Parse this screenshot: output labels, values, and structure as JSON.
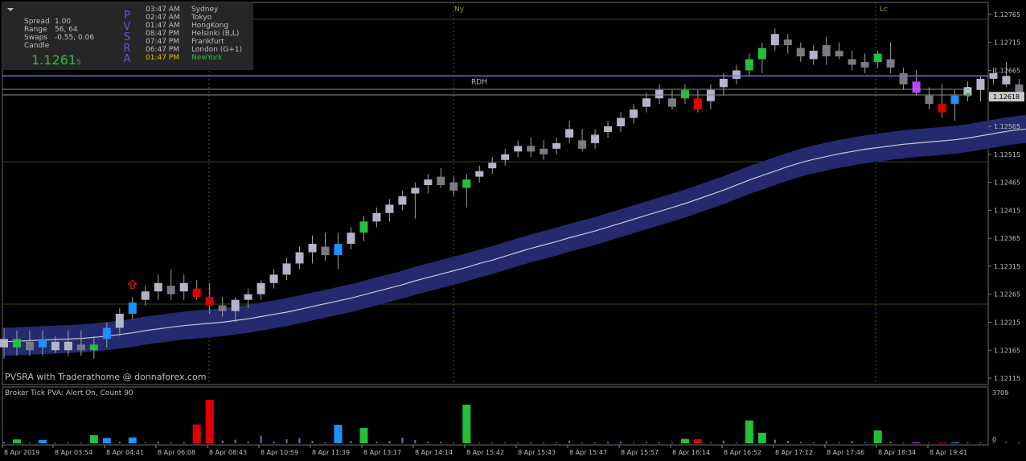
{
  "info": {
    "labels": [
      "Spread",
      "Range",
      "Swaps",
      "Candle"
    ],
    "values": [
      "1.00",
      "56, 64",
      "-0.55, 0.06",
      ""
    ],
    "price": "1.1261",
    "price_suffix": "5",
    "indicator_name": "PVSRA"
  },
  "sessions": [
    {
      "time": "03:47 AM",
      "name": "Sydney",
      "active": false
    },
    {
      "time": "02:47 AM",
      "name": "Tokyo",
      "active": false
    },
    {
      "time": "01:47 AM",
      "name": "HongKong",
      "active": false
    },
    {
      "time": "08:47 PM",
      "name": "Helsinki  (B,L)",
      "active": false
    },
    {
      "time": "07:47 PM",
      "name": "Frankfurt",
      "active": false
    },
    {
      "time": "06:47 PM",
      "name": "London  (G+1)",
      "active": false
    },
    {
      "time": "01:47 PM",
      "name": "NewYork",
      "active": true
    }
  ],
  "markers": {
    "ny": "Ny",
    "lc": "Lc",
    "rdh": "RDH"
  },
  "watermark": "PVSRA with Traderathome @ donnaforex.com",
  "current_price_label": "1.12618",
  "price_axis": [
    "1.12765",
    "1.12715",
    "1.12665",
    "1.12615",
    "1.12565",
    "1.12515",
    "1.12465",
    "1.12415",
    "1.12365",
    "1.12315",
    "1.12265",
    "1.12215",
    "1.12165",
    "1.12115"
  ],
  "sub_panel": {
    "title": "Broker Tick PVA:    Alert On,  Count  90",
    "scale_max": "3709",
    "scale_min": "0"
  },
  "time_axis": [
    "8 Apr 2019",
    "8 Apr 03:54",
    "8 Apr 04:41",
    "8 Apr 06:08",
    "8 Apr 08:43",
    "8 Apr 10:59",
    "8 Apr 11:39",
    "8 Apr 13:17",
    "8 Apr 14:14",
    "8 Apr 15:42",
    "8 Apr 15:43",
    "8 Apr 15:47",
    "8 Apr 15:57",
    "8 Apr 16:14",
    "8 Apr 16:52",
    "8 Apr 17:12",
    "8 Apr 17:46",
    "8 Apr 18:34",
    "8 Apr 19:41"
  ],
  "colors": {
    "background": "#000000",
    "bull_normal": "#b4b4c8",
    "bear_normal": "#7a7a82",
    "climax_bull": "#1e90ff",
    "climax_bear": "#e00000",
    "rising_bull": "#22c03c",
    "rising_bear": "#c040ff",
    "band": "#252a6e",
    "rdh_line": "#7070f0",
    "session_active": "#e0c000",
    "session_text": "#bfbfbf",
    "newyork": "#22c03c"
  },
  "chart_data": {
    "type": "candlestick",
    "ylim": [
      1.12105,
      1.12785
    ],
    "rdh": 1.12655,
    "current_price": 1.12618,
    "band_width_price": 0.00025,
    "candles": [
      {
        "o": 1.12185,
        "h": 1.12205,
        "l": 1.1215,
        "c": 1.1217,
        "t": "bull_normal"
      },
      {
        "o": 1.1217,
        "h": 1.122,
        "l": 1.12155,
        "c": 1.12185,
        "t": "rising_bull"
      },
      {
        "o": 1.1218,
        "h": 1.122,
        "l": 1.12155,
        "c": 1.12165,
        "t": "bear_normal"
      },
      {
        "o": 1.1217,
        "h": 1.122,
        "l": 1.12155,
        "c": 1.12185,
        "t": "climax_bull"
      },
      {
        "o": 1.1218,
        "h": 1.1219,
        "l": 1.1216,
        "c": 1.12165,
        "t": "bull_normal"
      },
      {
        "o": 1.12165,
        "h": 1.122,
        "l": 1.12155,
        "c": 1.1218,
        "t": "bull_normal"
      },
      {
        "o": 1.12175,
        "h": 1.122,
        "l": 1.12155,
        "c": 1.12165,
        "t": "bear_normal"
      },
      {
        "o": 1.12165,
        "h": 1.1219,
        "l": 1.1215,
        "c": 1.12175,
        "t": "rising_bull"
      },
      {
        "o": 1.12185,
        "h": 1.12215,
        "l": 1.1217,
        "c": 1.12205,
        "t": "climax_bull"
      },
      {
        "o": 1.12205,
        "h": 1.1224,
        "l": 1.1219,
        "c": 1.1223,
        "t": "bull_normal"
      },
      {
        "o": 1.1223,
        "h": 1.1226,
        "l": 1.1222,
        "c": 1.1225,
        "t": "climax_bull"
      },
      {
        "o": 1.12255,
        "h": 1.1228,
        "l": 1.12245,
        "c": 1.1227,
        "t": "bull_normal"
      },
      {
        "o": 1.1227,
        "h": 1.123,
        "l": 1.12255,
        "c": 1.12285,
        "t": "bull_normal"
      },
      {
        "o": 1.1228,
        "h": 1.1231,
        "l": 1.12255,
        "c": 1.12265,
        "t": "bear_normal"
      },
      {
        "o": 1.1227,
        "h": 1.123,
        "l": 1.12255,
        "c": 1.12285,
        "t": "bull_normal"
      },
      {
        "o": 1.12275,
        "h": 1.1229,
        "l": 1.12255,
        "c": 1.1226,
        "t": "climax_bear"
      },
      {
        "o": 1.1226,
        "h": 1.12285,
        "l": 1.1223,
        "c": 1.12245,
        "t": "climax_bear"
      },
      {
        "o": 1.12245,
        "h": 1.1226,
        "l": 1.12225,
        "c": 1.12235,
        "t": "bear_normal"
      },
      {
        "o": 1.12235,
        "h": 1.1226,
        "l": 1.12215,
        "c": 1.12255,
        "t": "bull_normal"
      },
      {
        "o": 1.12255,
        "h": 1.12275,
        "l": 1.1224,
        "c": 1.12265,
        "t": "bull_normal"
      },
      {
        "o": 1.12265,
        "h": 1.1229,
        "l": 1.12255,
        "c": 1.12285,
        "t": "bull_normal"
      },
      {
        "o": 1.12285,
        "h": 1.1231,
        "l": 1.12275,
        "c": 1.123,
        "t": "bull_normal"
      },
      {
        "o": 1.123,
        "h": 1.1233,
        "l": 1.1229,
        "c": 1.1232,
        "t": "bull_normal"
      },
      {
        "o": 1.1232,
        "h": 1.1235,
        "l": 1.1231,
        "c": 1.1234,
        "t": "bull_normal"
      },
      {
        "o": 1.1234,
        "h": 1.1237,
        "l": 1.1232,
        "c": 1.12355,
        "t": "bull_normal"
      },
      {
        "o": 1.1235,
        "h": 1.12375,
        "l": 1.12325,
        "c": 1.12335,
        "t": "bear_normal"
      },
      {
        "o": 1.12335,
        "h": 1.12375,
        "l": 1.1231,
        "c": 1.12355,
        "t": "climax_bull"
      },
      {
        "o": 1.12355,
        "h": 1.12385,
        "l": 1.12345,
        "c": 1.12375,
        "t": "bull_normal"
      },
      {
        "o": 1.12375,
        "h": 1.12405,
        "l": 1.1236,
        "c": 1.12395,
        "t": "rising_bull"
      },
      {
        "o": 1.12395,
        "h": 1.1242,
        "l": 1.12385,
        "c": 1.1241,
        "t": "bull_normal"
      },
      {
        "o": 1.1241,
        "h": 1.12435,
        "l": 1.12395,
        "c": 1.12425,
        "t": "bull_normal"
      },
      {
        "o": 1.12425,
        "h": 1.1245,
        "l": 1.12415,
        "c": 1.1244,
        "t": "bull_normal"
      },
      {
        "o": 1.12445,
        "h": 1.12465,
        "l": 1.124,
        "c": 1.12455,
        "t": "bull_normal"
      },
      {
        "o": 1.1246,
        "h": 1.1248,
        "l": 1.12445,
        "c": 1.1247,
        "t": "bull_normal"
      },
      {
        "o": 1.12475,
        "h": 1.1249,
        "l": 1.12455,
        "c": 1.1246,
        "t": "bear_normal"
      },
      {
        "o": 1.12465,
        "h": 1.12475,
        "l": 1.1244,
        "c": 1.1245,
        "t": "bear_normal"
      },
      {
        "o": 1.12455,
        "h": 1.1248,
        "l": 1.1242,
        "c": 1.1247,
        "t": "rising_bull"
      },
      {
        "o": 1.12475,
        "h": 1.12495,
        "l": 1.12465,
        "c": 1.12485,
        "t": "bull_normal"
      },
      {
        "o": 1.1249,
        "h": 1.1251,
        "l": 1.1248,
        "c": 1.125,
        "t": "bull_normal"
      },
      {
        "o": 1.12505,
        "h": 1.12525,
        "l": 1.12495,
        "c": 1.12515,
        "t": "bull_normal"
      },
      {
        "o": 1.1252,
        "h": 1.1254,
        "l": 1.1251,
        "c": 1.1253,
        "t": "bull_normal"
      },
      {
        "o": 1.1253,
        "h": 1.12545,
        "l": 1.1251,
        "c": 1.1252,
        "t": "bear_normal"
      },
      {
        "o": 1.12525,
        "h": 1.1254,
        "l": 1.12505,
        "c": 1.12515,
        "t": "bear_normal"
      },
      {
        "o": 1.12525,
        "h": 1.12545,
        "l": 1.12515,
        "c": 1.12535,
        "t": "bull_normal"
      },
      {
        "o": 1.12545,
        "h": 1.12575,
        "l": 1.12535,
        "c": 1.1256,
        "t": "bull_normal"
      },
      {
        "o": 1.1254,
        "h": 1.1256,
        "l": 1.1252,
        "c": 1.12525,
        "t": "bear_normal"
      },
      {
        "o": 1.12535,
        "h": 1.1256,
        "l": 1.12525,
        "c": 1.1255,
        "t": "bull_normal"
      },
      {
        "o": 1.12555,
        "h": 1.12575,
        "l": 1.12545,
        "c": 1.12565,
        "t": "bull_normal"
      },
      {
        "o": 1.12565,
        "h": 1.1259,
        "l": 1.12555,
        "c": 1.1258,
        "t": "bull_normal"
      },
      {
        "o": 1.1258,
        "h": 1.12605,
        "l": 1.1257,
        "c": 1.12595,
        "t": "bull_normal"
      },
      {
        "o": 1.126,
        "h": 1.12625,
        "l": 1.1259,
        "c": 1.12615,
        "t": "bull_normal"
      },
      {
        "o": 1.12615,
        "h": 1.1264,
        "l": 1.12605,
        "c": 1.1263,
        "t": "bull_normal"
      },
      {
        "o": 1.12615,
        "h": 1.1263,
        "l": 1.12595,
        "c": 1.126,
        "t": "bear_normal"
      },
      {
        "o": 1.12615,
        "h": 1.1264,
        "l": 1.12605,
        "c": 1.1263,
        "t": "rising_bull"
      },
      {
        "o": 1.12615,
        "h": 1.1263,
        "l": 1.1259,
        "c": 1.12595,
        "t": "climax_bear"
      },
      {
        "o": 1.1261,
        "h": 1.1264,
        "l": 1.12595,
        "c": 1.1263,
        "t": "bull_normal"
      },
      {
        "o": 1.12635,
        "h": 1.1266,
        "l": 1.1262,
        "c": 1.1265,
        "t": "bull_normal"
      },
      {
        "o": 1.1265,
        "h": 1.12675,
        "l": 1.1264,
        "c": 1.12665,
        "t": "bull_normal"
      },
      {
        "o": 1.12665,
        "h": 1.12695,
        "l": 1.12655,
        "c": 1.12685,
        "t": "rising_bull"
      },
      {
        "o": 1.12685,
        "h": 1.12715,
        "l": 1.1266,
        "c": 1.12705,
        "t": "rising_bull"
      },
      {
        "o": 1.1271,
        "h": 1.1274,
        "l": 1.127,
        "c": 1.1273,
        "t": "bull_normal"
      },
      {
        "o": 1.1272,
        "h": 1.1273,
        "l": 1.12695,
        "c": 1.1271,
        "t": "bear_normal"
      },
      {
        "o": 1.12705,
        "h": 1.12715,
        "l": 1.1268,
        "c": 1.1269,
        "t": "bear_normal"
      },
      {
        "o": 1.127,
        "h": 1.1271,
        "l": 1.12675,
        "c": 1.12685,
        "t": "bull_normal"
      },
      {
        "o": 1.1271,
        "h": 1.12725,
        "l": 1.12675,
        "c": 1.1269,
        "t": "bear_normal"
      },
      {
        "o": 1.127,
        "h": 1.12715,
        "l": 1.12685,
        "c": 1.1269,
        "t": "bear_normal"
      },
      {
        "o": 1.12685,
        "h": 1.127,
        "l": 1.12665,
        "c": 1.12675,
        "t": "bear_normal"
      },
      {
        "o": 1.1268,
        "h": 1.12695,
        "l": 1.1266,
        "c": 1.1267,
        "t": "bear_normal"
      },
      {
        "o": 1.1268,
        "h": 1.127,
        "l": 1.1267,
        "c": 1.12695,
        "t": "rising_bull"
      },
      {
        "o": 1.12685,
        "h": 1.12715,
        "l": 1.1266,
        "c": 1.1267,
        "t": "bear_normal"
      },
      {
        "o": 1.1266,
        "h": 1.1267,
        "l": 1.1263,
        "c": 1.1264,
        "t": "bear_normal"
      },
      {
        "o": 1.12645,
        "h": 1.12665,
        "l": 1.1262,
        "c": 1.12625,
        "t": "rising_bear"
      },
      {
        "o": 1.1262,
        "h": 1.12635,
        "l": 1.12595,
        "c": 1.12605,
        "t": "bear_normal"
      },
      {
        "o": 1.12605,
        "h": 1.1264,
        "l": 1.1258,
        "c": 1.1259,
        "t": "climax_bear"
      },
      {
        "o": 1.12605,
        "h": 1.1263,
        "l": 1.12575,
        "c": 1.1262,
        "t": "climax_bull"
      },
      {
        "o": 1.1262,
        "h": 1.12645,
        "l": 1.1261,
        "c": 1.12635,
        "t": "bull_normal"
      },
      {
        "o": 1.1263,
        "h": 1.12655,
        "l": 1.1261,
        "c": 1.1265,
        "t": "bull_normal"
      },
      {
        "o": 1.1265,
        "h": 1.1267,
        "l": 1.1264,
        "c": 1.1266,
        "t": "bull_normal"
      },
      {
        "o": 1.12655,
        "h": 1.1268,
        "l": 1.12635,
        "c": 1.1264,
        "t": "bull_normal"
      },
      {
        "o": 1.1264,
        "h": 1.1265,
        "l": 1.1262,
        "c": 1.12625,
        "t": "bear_normal"
      },
      {
        "o": 1.12622,
        "h": 1.1263,
        "l": 1.12605,
        "c": 1.12618,
        "t": "bull_normal"
      }
    ],
    "ma": [
      1.1218,
      1.12181,
      1.12182,
      1.12183,
      1.12184,
      1.12185,
      1.12186,
      1.12188,
      1.1219,
      1.12193,
      1.12196,
      1.122,
      1.12203,
      1.12206,
      1.12209,
      1.12211,
      1.12213,
      1.12215,
      1.12218,
      1.12221,
      1.12225,
      1.12229,
      1.12233,
      1.12238,
      1.12243,
      1.12248,
      1.12253,
      1.12258,
      1.12264,
      1.1227,
      1.12276,
      1.12282,
      1.12289,
      1.12295,
      1.12301,
      1.12307,
      1.12313,
      1.1232,
      1.12326,
      1.12333,
      1.1234,
      1.12347,
      1.12353,
      1.12359,
      1.12366,
      1.12372,
      1.12378,
      1.12385,
      1.12392,
      1.12399,
      1.12406,
      1.12413,
      1.1242,
      1.12427,
      1.12435,
      1.12443,
      1.12451,
      1.1246,
      1.12469,
      1.12477,
      1.12485,
      1.12493,
      1.125,
      1.12506,
      1.12511,
      1.12516,
      1.1252,
      1.12524,
      1.12527,
      1.1253,
      1.12533,
      1.12535,
      1.12537,
      1.12539,
      1.12541,
      1.12544,
      1.12548,
      1.12552,
      1.12556,
      1.12559,
      1.12561
    ],
    "volume": [
      {
        "v": 120,
        "t": "bull"
      },
      {
        "v": 330,
        "t": "rising_bull"
      },
      {
        "v": 60,
        "t": "bear"
      },
      {
        "v": 280,
        "t": "climax_bull"
      },
      {
        "v": 40,
        "t": "bull"
      },
      {
        "v": 90,
        "t": "bull"
      },
      {
        "v": 60,
        "t": "bear"
      },
      {
        "v": 700,
        "t": "rising_bull"
      },
      {
        "v": 450,
        "t": "climax_bull"
      },
      {
        "v": 130,
        "t": "bull"
      },
      {
        "v": 500,
        "t": "climax_bull"
      },
      {
        "v": 100,
        "t": "bull"
      },
      {
        "v": 150,
        "t": "bull"
      },
      {
        "v": 70,
        "t": "bear"
      },
      {
        "v": 100,
        "t": "bull"
      },
      {
        "v": 1600,
        "t": "climax_bear"
      },
      {
        "v": 3700,
        "t": "climax_bear"
      },
      {
        "v": 220,
        "t": "bear"
      },
      {
        "v": 300,
        "t": "bull"
      },
      {
        "v": 160,
        "t": "bull"
      },
      {
        "v": 650,
        "t": "bull"
      },
      {
        "v": 160,
        "t": "bull"
      },
      {
        "v": 350,
        "t": "bull"
      },
      {
        "v": 450,
        "t": "bull"
      },
      {
        "v": 200,
        "t": "bull"
      },
      {
        "v": 90,
        "t": "bear"
      },
      {
        "v": 1580,
        "t": "climax_bull"
      },
      {
        "v": 190,
        "t": "bull"
      },
      {
        "v": 1300,
        "t": "rising_bull"
      },
      {
        "v": 150,
        "t": "bull"
      },
      {
        "v": 200,
        "t": "bull"
      },
      {
        "v": 490,
        "t": "bull"
      },
      {
        "v": 270,
        "t": "bull"
      },
      {
        "v": 150,
        "t": "bull"
      },
      {
        "v": 120,
        "t": "bear"
      },
      {
        "v": 60,
        "t": "bear"
      },
      {
        "v": 3300,
        "t": "rising_bull"
      },
      {
        "v": 80,
        "t": "bull"
      },
      {
        "v": 50,
        "t": "bull"
      },
      {
        "v": 70,
        "t": "bull"
      },
      {
        "v": 60,
        "t": "bull"
      },
      {
        "v": 80,
        "t": "bear"
      },
      {
        "v": 60,
        "t": "bear"
      },
      {
        "v": 90,
        "t": "bull"
      },
      {
        "v": 200,
        "t": "bull"
      },
      {
        "v": 70,
        "t": "bear"
      },
      {
        "v": 90,
        "t": "bull"
      },
      {
        "v": 120,
        "t": "bull"
      },
      {
        "v": 150,
        "t": "bull"
      },
      {
        "v": 90,
        "t": "bull"
      },
      {
        "v": 100,
        "t": "bull"
      },
      {
        "v": 100,
        "t": "bull"
      },
      {
        "v": 90,
        "t": "bear"
      },
      {
        "v": 380,
        "t": "rising_bull"
      },
      {
        "v": 350,
        "t": "climax_bear"
      },
      {
        "v": 80,
        "t": "bull"
      },
      {
        "v": 220,
        "t": "bull"
      },
      {
        "v": 90,
        "t": "bull"
      },
      {
        "v": 1950,
        "t": "rising_bull"
      },
      {
        "v": 900,
        "t": "rising_bull"
      },
      {
        "v": 300,
        "t": "bull"
      },
      {
        "v": 200,
        "t": "bear"
      },
      {
        "v": 120,
        "t": "bear"
      },
      {
        "v": 90,
        "t": "bull"
      },
      {
        "v": 150,
        "t": "bear"
      },
      {
        "v": 90,
        "t": "bear"
      },
      {
        "v": 200,
        "t": "bear"
      },
      {
        "v": 100,
        "t": "bear"
      },
      {
        "v": 1100,
        "t": "rising_bull"
      },
      {
        "v": 150,
        "t": "bear"
      },
      {
        "v": 60,
        "t": "bear"
      },
      {
        "v": 80,
        "t": "rising_bear"
      },
      {
        "v": 70,
        "t": "bear"
      },
      {
        "v": 60,
        "t": "climax_bear"
      },
      {
        "v": 80,
        "t": "climax_bull"
      },
      {
        "v": 80,
        "t": "bull"
      },
      {
        "v": 90,
        "t": "bull"
      },
      {
        "v": 60,
        "t": "bull"
      },
      {
        "v": 100,
        "t": "bull"
      },
      {
        "v": 60,
        "t": "bear"
      },
      {
        "v": 40,
        "t": "bull"
      }
    ]
  }
}
